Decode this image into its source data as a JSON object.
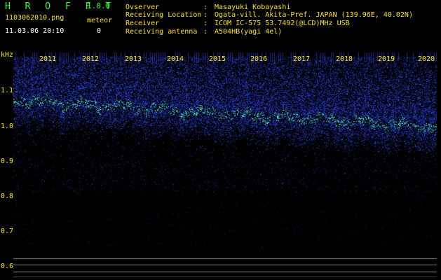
{
  "header": {
    "app_title": "H R O F F T",
    "version": "1.0.0",
    "filename": "1103062010.png",
    "datetime": "11.03.06 20:10",
    "meteor_label": "meteor",
    "meteor_count": "0"
  },
  "info": [
    {
      "label": "Ovserver",
      "value": "Masayuki Kobayashi"
    },
    {
      "label": "Receiving Location",
      "value": "Ogata-vill. Akita-Pref. JAPAN (139.96E, 40.02N)"
    },
    {
      "label": "Receiver",
      "value": "ICOM IC-575 53.7492(@LCD)MHz USB"
    },
    {
      "label": "Receiving antenna",
      "value": "A504HB(yagi 4el)"
    }
  ],
  "separator": ":",
  "axis": {
    "unit": "kHz",
    "years": [
      "2011",
      "2012",
      "2013",
      "2014",
      "2015",
      "2016",
      "2017",
      "2018",
      "2019",
      "2020"
    ],
    "ticks": [
      "1.1",
      "1.0",
      "0.9",
      "0.8",
      "0.7",
      "0.6"
    ]
  },
  "colors": {
    "title_green": "#39ff3a",
    "label_yellow": "#ffe500",
    "background": "#000000",
    "signal_cyan": "#3cf0c8",
    "noise_blue": "#1a2aa0"
  }
}
